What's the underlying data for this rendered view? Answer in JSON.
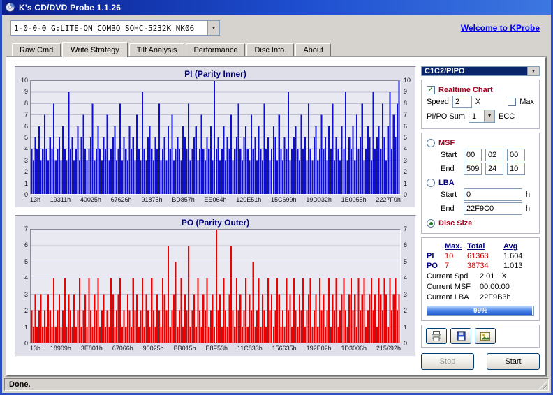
{
  "window": {
    "title": "K's CD/DVD Probe 1.1.26"
  },
  "toolbar": {
    "drive_combo_value": "1-0-0-0 G:LITE-ON COMBO SOHC-5232K NK06",
    "welcome_link": "Welcome to KProbe"
  },
  "tabs": [
    {
      "label": "Raw Cmd",
      "active": false
    },
    {
      "label": "Write Strategy",
      "active": true
    },
    {
      "label": "Tilt Analysis",
      "active": false
    },
    {
      "label": "Performance",
      "active": false
    },
    {
      "label": "Disc Info.",
      "active": false
    },
    {
      "label": "About",
      "active": false
    }
  ],
  "chart_data": [
    {
      "type": "bar",
      "title": "PI (Parity Inner)",
      "xlabel": "",
      "ylabel": "",
      "ylim": [
        0,
        10
      ],
      "ytick_step": 1,
      "grid": true,
      "legend": "none",
      "bar_color": "#0f0fd2",
      "x_tick_labels": [
        "13h",
        "19311h",
        "40025h",
        "67626h",
        "91875h",
        "BD857h",
        "EE064h",
        "120E51h",
        "15C699h",
        "19D032h",
        "1E0055h",
        "2227F0h"
      ],
      "values": [
        4,
        3,
        5,
        4,
        6,
        3,
        4,
        7,
        4,
        3,
        5,
        4,
        8,
        3,
        4,
        5,
        3,
        6,
        4,
        3,
        9,
        4,
        5,
        3,
        4,
        6,
        3,
        5,
        7,
        4,
        3,
        4,
        5,
        8,
        3,
        4,
        6,
        4,
        3,
        5,
        4,
        7,
        3,
        4,
        5,
        6,
        3,
        4,
        8,
        3,
        5,
        4,
        3,
        6,
        4,
        5,
        3,
        7,
        4,
        3,
        9,
        4,
        3,
        5,
        6,
        4,
        3,
        5,
        4,
        8,
        3,
        4,
        5,
        3,
        6,
        4,
        7,
        3,
        4,
        5,
        4,
        3,
        6,
        5,
        4,
        8,
        3,
        4,
        5,
        6,
        3,
        4,
        7,
        4,
        3,
        5,
        4,
        6,
        3,
        10,
        4,
        5,
        3,
        4,
        6,
        3,
        5,
        4,
        7,
        3,
        4,
        5,
        8,
        4,
        3,
        5,
        6,
        4,
        3,
        7,
        4,
        5,
        3,
        6,
        4,
        3,
        8,
        4,
        5,
        3,
        4,
        6,
        5,
        3,
        7,
        4,
        3,
        5,
        4,
        9,
        3,
        4,
        5,
        6,
        4,
        3,
        7,
        4,
        5,
        3,
        8,
        4,
        3,
        5,
        6,
        3,
        4,
        7,
        4,
        5,
        3,
        6,
        4,
        8,
        3,
        5,
        4,
        3,
        6,
        4,
        9,
        3,
        5,
        4,
        6,
        3,
        7,
        4,
        5,
        8,
        3,
        4,
        6,
        5,
        3,
        9,
        4,
        5,
        6,
        4,
        8,
        5,
        3,
        6,
        9,
        4,
        7,
        5,
        8,
        10
      ]
    },
    {
      "type": "bar",
      "title": "PO (Parity Outer)",
      "xlabel": "",
      "ylabel": "",
      "ylim": [
        0,
        7
      ],
      "ytick_step": 1,
      "grid": true,
      "legend": "none",
      "bar_color": "#ee0000",
      "x_tick_labels": [
        "13h",
        "18909h",
        "3E801h",
        "67066h",
        "90025h",
        "BB015h",
        "E8F53h",
        "11C833h",
        "156635h",
        "192E02h",
        "1D3006h",
        "215692h"
      ],
      "values": [
        2,
        1,
        3,
        1,
        2,
        3,
        1,
        2,
        1,
        3,
        2,
        1,
        4,
        1,
        2,
        3,
        1,
        2,
        4,
        1,
        3,
        2,
        1,
        3,
        1,
        2,
        4,
        1,
        2,
        3,
        1,
        4,
        2,
        1,
        3,
        2,
        4,
        1,
        2,
        3,
        1,
        2,
        1,
        4,
        3,
        1,
        2,
        3,
        4,
        1,
        2,
        1,
        3,
        2,
        1,
        4,
        2,
        3,
        1,
        2,
        4,
        1,
        3,
        2,
        1,
        4,
        2,
        1,
        3,
        2,
        1,
        4,
        3,
        2,
        6,
        1,
        2,
        3,
        5,
        1,
        2,
        4,
        1,
        3,
        2,
        6,
        1,
        2,
        3,
        1,
        4,
        2,
        1,
        3,
        2,
        4,
        1,
        2,
        3,
        1,
        7,
        2,
        3,
        1,
        4,
        2,
        1,
        3,
        6,
        2,
        1,
        4,
        2,
        3,
        1,
        2,
        4,
        1,
        3,
        2,
        5,
        1,
        2,
        4,
        1,
        3,
        2,
        1,
        4,
        2,
        3,
        1,
        2,
        4,
        3,
        1,
        2,
        1,
        4,
        2,
        3,
        1,
        4,
        2,
        1,
        3,
        2,
        4,
        1,
        2,
        3,
        4,
        1,
        2,
        3,
        1,
        4,
        2,
        3,
        1,
        2,
        4,
        1,
        3,
        2,
        4,
        1,
        2,
        3,
        4,
        2,
        1,
        3,
        4,
        2,
        3,
        1,
        4,
        2,
        3,
        4,
        1,
        2,
        3,
        4,
        2,
        3,
        1,
        4,
        3,
        2,
        4,
        3,
        1,
        4,
        2,
        3,
        4,
        2,
        3
      ]
    }
  ],
  "sidebar": {
    "mode_combo_value": "C1C2/PIPO",
    "realtime_chart_label": "Realtime Chart",
    "speed_label": "Speed",
    "speed_value": "2",
    "speed_unit": "X",
    "max_label": "Max",
    "pipo_sum_label": "PI/PO Sum",
    "pipo_sum_value": "1",
    "ecc_label": "ECC",
    "msf_label": "MSF",
    "msf_start_label": "Start",
    "msf_end_label": "End",
    "msf_start": [
      "00",
      "02",
      "00"
    ],
    "msf_end": [
      "509",
      "24",
      "10"
    ],
    "lba_label": "LBA",
    "lba_start_label": "Start",
    "lba_end_label": "End",
    "lba_start_value": "0",
    "lba_end_value": "22F9C0",
    "lba_unit": "h",
    "disc_size_label": "Disc Size",
    "stats": {
      "header_max": "Max.",
      "header_total": "Total",
      "header_avg": "Avg",
      "rows": [
        {
          "label": "PI",
          "max": "10",
          "total": "61363",
          "avg": "1.604"
        },
        {
          "label": "PO",
          "max": "7",
          "total": "38734",
          "avg": "1.013"
        }
      ],
      "current_spd_label": "Current Spd",
      "current_spd_value": "2.01",
      "current_spd_unit": "X",
      "current_msf_label": "Current MSF",
      "current_msf_value": "00:00:00",
      "current_lba_label": "Current LBA",
      "current_lba_value": "22F9B3h",
      "progress_percent": 99,
      "progress_text": "99%"
    },
    "stop_button": "Stop",
    "start_button": "Start"
  },
  "status_bar": {
    "text": "Done."
  },
  "colors": {
    "titlebar_start": "#0a1f8f",
    "titlebar_end": "#3d77e0",
    "chrome": "#d6d3ce",
    "pi_bar": "#0f0fd2",
    "po_bar": "#ee0000",
    "accent_navy": "#000080",
    "accent_red": "#a50021",
    "value_red": "#cc0000"
  }
}
